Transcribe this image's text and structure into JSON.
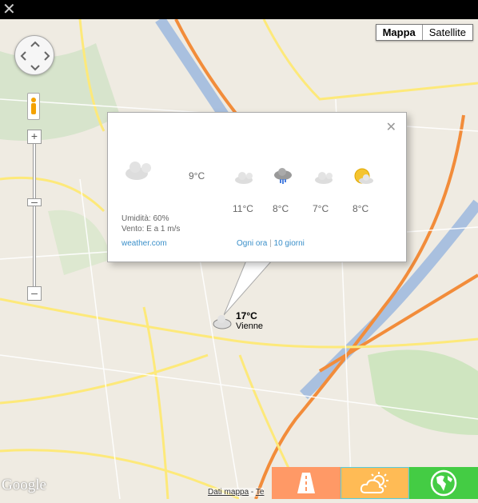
{
  "app": {
    "close_icon": "close-icon"
  },
  "map": {
    "type_buttons": [
      "Mappa",
      "Satellite"
    ],
    "selected": "Mappa",
    "attribution": [
      "Dati mappa",
      "Te"
    ],
    "logo": "Google"
  },
  "popup": {
    "current_temp": "9°C",
    "humidity": "Umidità: 60%",
    "wind": "Vento: E a 1 m/s",
    "source_link": "weather.com",
    "hourly_link": "Ogni ora",
    "separator": "|",
    "ten_day_link": "10 giorni",
    "forecast": [
      {
        "icon": "partly-cloudy-icon",
        "temp": "11°C"
      },
      {
        "icon": "rain-icon",
        "temp": "8°C"
      },
      {
        "icon": "partly-cloudy-icon",
        "temp": "7°C"
      },
      {
        "icon": "sun-cloud-icon",
        "temp": "8°C"
      }
    ]
  },
  "marker": {
    "temp": "17°C",
    "city": "Vienne"
  },
  "bottom_buttons": [
    {
      "name": "traffic",
      "color": "#ff9966"
    },
    {
      "name": "weather",
      "color": "#ffbb55"
    },
    {
      "name": "earth",
      "color": "#44cc44"
    }
  ]
}
